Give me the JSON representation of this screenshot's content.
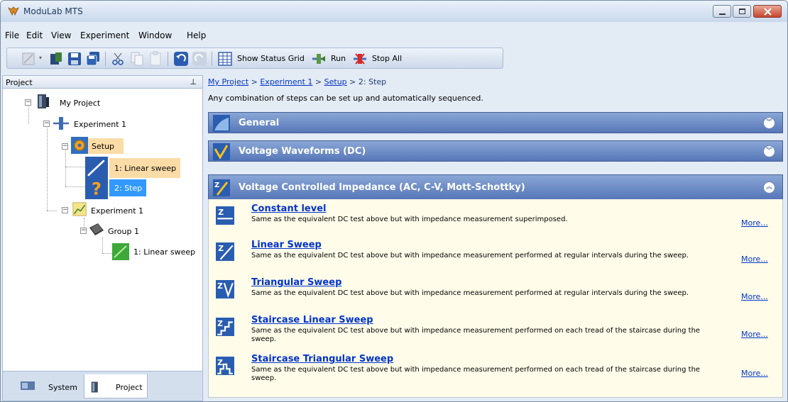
{
  "window": {
    "title": "ModuLab MTS"
  },
  "menu": [
    "File",
    "Edit",
    "View",
    "Experiment",
    "Window",
    "Help"
  ],
  "toolbar": {
    "status_grid": "Show Status Grid",
    "run": "Run",
    "stop_all": "Stop All"
  },
  "project_panel": {
    "title": "Project",
    "tree": {
      "root": "My Project",
      "experiment1": "Experiment 1",
      "setup": "Setup",
      "step1": "1: Linear sweep",
      "step2": "2: Step",
      "experiment1b": "Experiment 1",
      "group": "Group 1",
      "group_step": "1: Linear sweep"
    },
    "tabs": [
      "System",
      "Project"
    ]
  },
  "breadcrumb": {
    "p1": "My Project",
    "sep": " > ",
    "p2": "Experiment 1",
    "p3": "Setup",
    "p4": "2: Step"
  },
  "description": "Any combination of steps can be set up and automatically sequenced.",
  "sections": [
    {
      "title": "General",
      "expanded": false
    },
    {
      "title": "Voltage Waveforms (DC)",
      "expanded": false
    },
    {
      "title": "Voltage Controlled Impedance (AC, C-V, Mott-Schottky)",
      "expanded": true
    }
  ],
  "items": [
    {
      "title": "Constant level",
      "desc": "Same as the equivalent DC test above but with impedance measurement superimposed.",
      "more": "More..."
    },
    {
      "title": "Linear Sweep",
      "desc": "Same as the equivalent DC test above but with impedance measurement performed at regular intervals during the sweep.",
      "more": "More..."
    },
    {
      "title": "Triangular Sweep",
      "desc": "Same as the equivalent DC test above but with impedance measurement performed at regular intervals during the sweep.",
      "more": "More..."
    },
    {
      "title": "Staircase Linear Sweep",
      "desc": "Same as the equivalent DC test above but with impedance measurement performed on each tread of the staircase during the sweep.",
      "more": "More..."
    },
    {
      "title": "Staircase Triangular Sweep",
      "desc": "Same as the equivalent DC test above but with impedance measurement performed on each tread of the staircase during the sweep.",
      "more": "More..."
    }
  ],
  "colors": {
    "accent": "#5676b8",
    "link": "#0033cc",
    "selection": "#3399ff",
    "highlight": "#fbdca6"
  }
}
